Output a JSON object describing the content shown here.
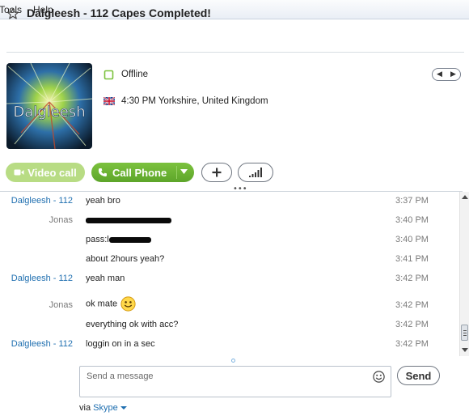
{
  "menu": {
    "items": [
      "Tools",
      "Help"
    ]
  },
  "header": {
    "title": "Dalgleesh - 112 Capes Completed!"
  },
  "profile": {
    "avatar_text": "Dalgleesh",
    "status": "Offline",
    "location": "4:30 PM Yorkshire, United Kingdom"
  },
  "actions": {
    "video_label": "Video call",
    "call_label": "Call Phone"
  },
  "chat": {
    "messages": [
      {
        "sender": "Dalgleesh - 112",
        "text": "yeah bro",
        "time": "3:37 PM"
      },
      {
        "sender": "Jonas",
        "text": "",
        "time": "3:40 PM"
      },
      {
        "sender": "",
        "text": "pass:l",
        "time": "3:40 PM"
      },
      {
        "sender": "",
        "text": "about 2hours yeah?",
        "time": "3:41 PM"
      },
      {
        "sender": "Dalgleesh - 112",
        "text": "yeah man",
        "time": "3:42 PM"
      },
      {
        "sender": "Jonas",
        "text": "ok mate",
        "time": "3:42 PM"
      },
      {
        "sender": "",
        "text": "everything ok with acc?",
        "time": "3:42 PM"
      },
      {
        "sender": "Dalgleesh - 112",
        "text": "loggin on in a sec",
        "time": "3:42 PM"
      }
    ]
  },
  "composer": {
    "placeholder": "Send a message",
    "send_label": "Send",
    "via_label": "via",
    "network": "Skype"
  },
  "colors": {
    "call_green": "#6ab432",
    "video_green_disabled": "#b8dc84",
    "link_blue": "#1f6fb0"
  }
}
